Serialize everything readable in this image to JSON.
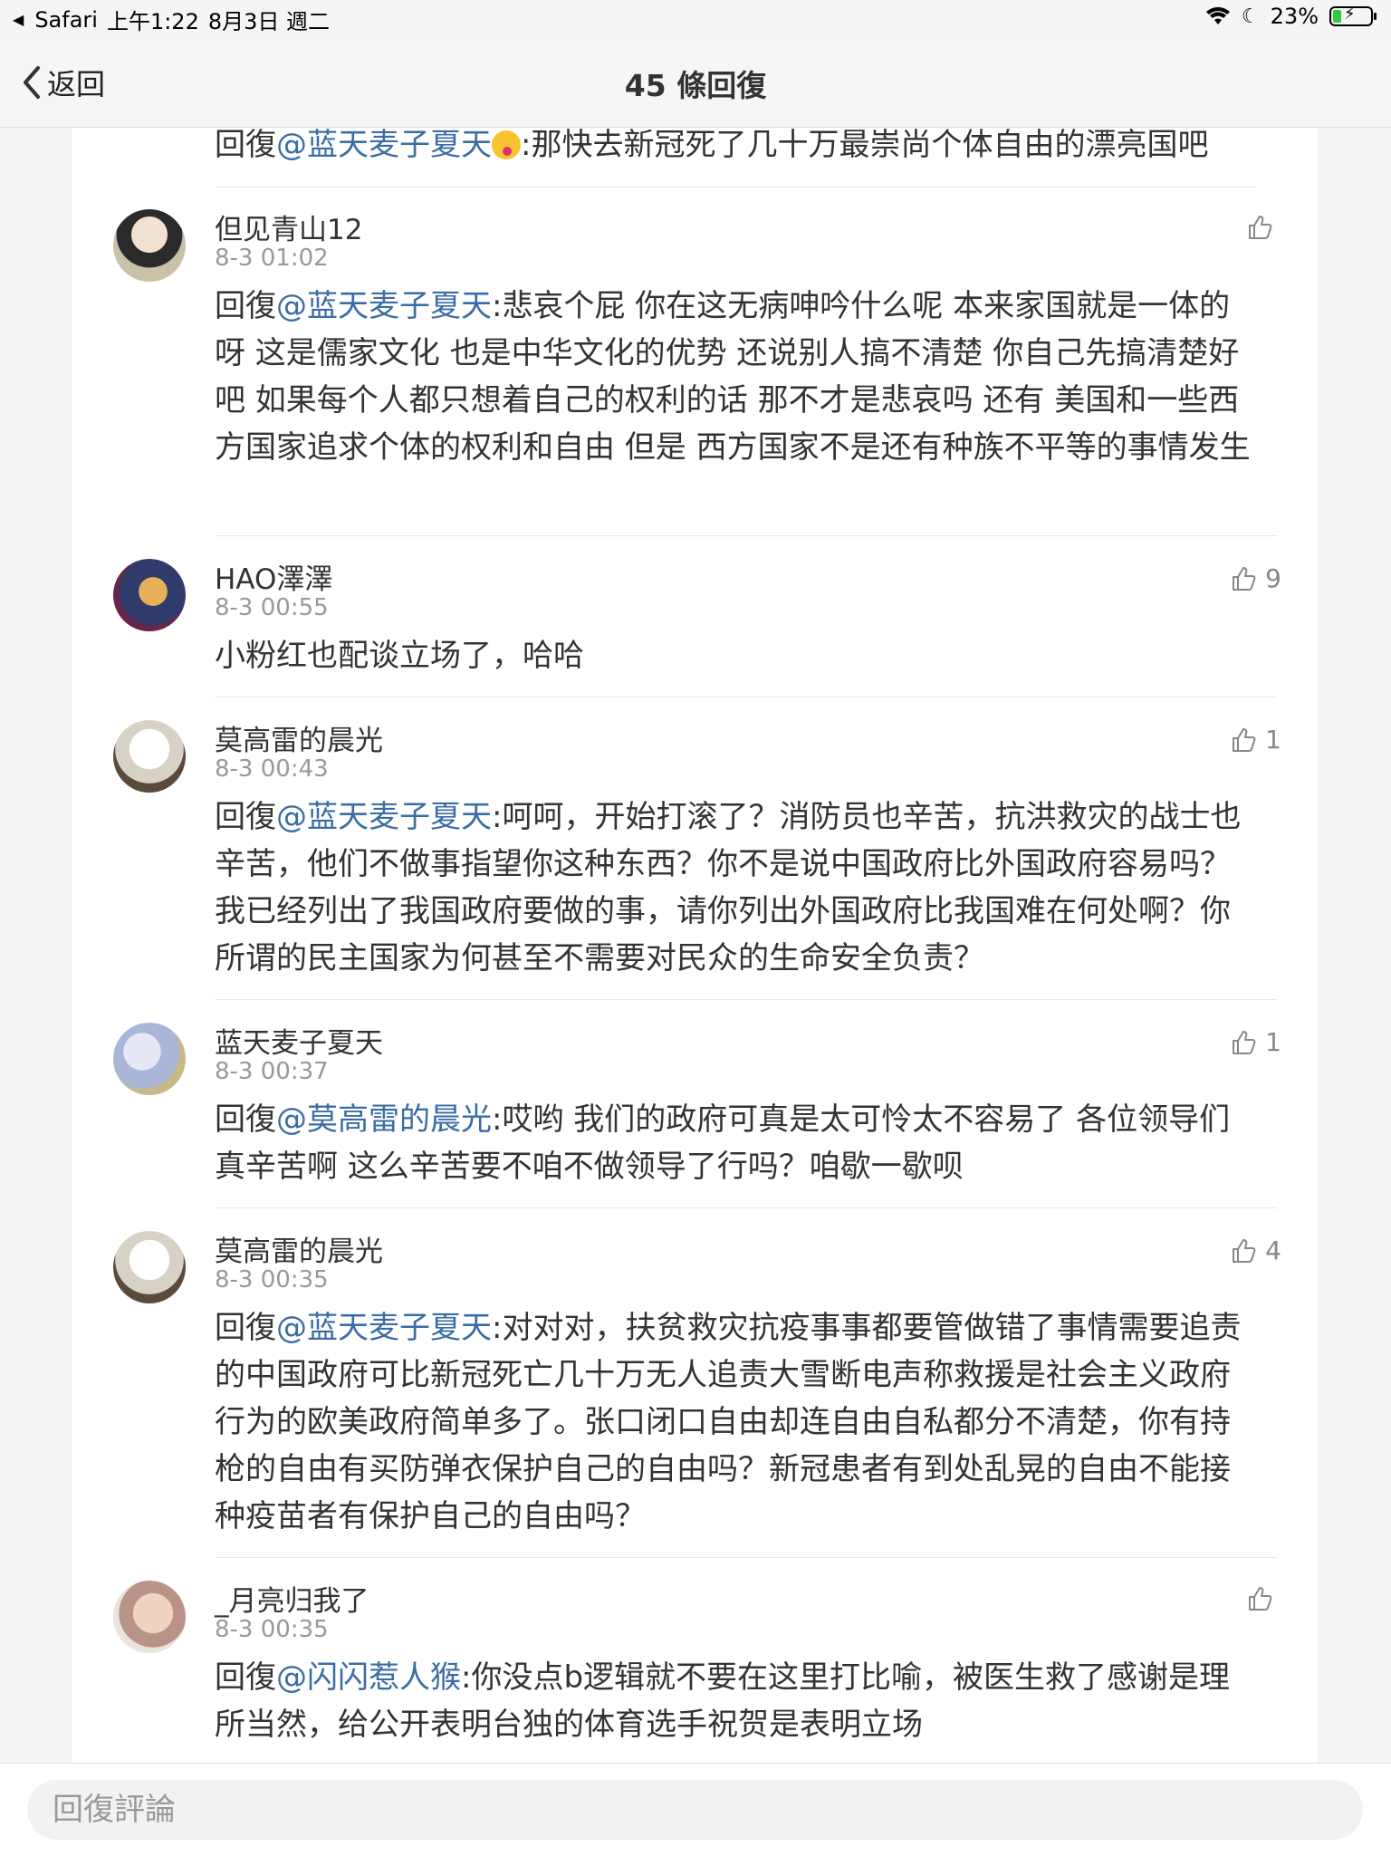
{
  "status_bar": {
    "app": "Safari",
    "time": "上午1:22",
    "date": "8月3日 週二",
    "battery": "23%",
    "battery_level": 0.23
  },
  "nav": {
    "back_label": "返回",
    "title": "45 條回復"
  },
  "partial_comment": {
    "prefix": "回復",
    "mention": "@蓝天麦子夏天",
    "text": ":那快去新冠死了几十万最崇尚个体自由的漂亮国吧"
  },
  "comments": [
    {
      "user": "但见青山12",
      "time": "8-3 01:02",
      "likes": "",
      "prefix": "回復",
      "mention": "@蓝天麦子夏天",
      "text": ":悲哀个屁  你在这无病呻吟什么呢  本来家国就是一体的呀  这是儒家文化  也是中华文化的优势  还说别人搞不清楚  你自己先搞清楚好吧  如果每个人都只想着自己的权利的话  那不才是悲哀吗  还有  美国和一些西方国家追求个体的权利和自由  但是  西方国家不是还有种族不平等的事情发生"
    },
    {
      "user": "HAO澤澤",
      "time": "8-3 00:55",
      "likes": "9",
      "prefix": "",
      "mention": "",
      "text": "小粉红也配谈立场了，哈哈"
    },
    {
      "user": "莫高雷的晨光",
      "time": "8-3 00:43",
      "likes": "1",
      "prefix": "回復",
      "mention": "@蓝天麦子夏天",
      "text": ":呵呵，开始打滚了？消防员也辛苦，抗洪救灾的战士也辛苦，他们不做事指望你这种东西？你不是说中国政府比外国政府容易吗？我已经列出了我国政府要做的事，请你列出外国政府比我国难在何处啊？你所谓的民主国家为何甚至不需要对民众的生命安全负责？"
    },
    {
      "user": "蓝天麦子夏天",
      "time": "8-3 00:37",
      "likes": "1",
      "prefix": "回復",
      "mention": "@莫高雷的晨光",
      "text": ":哎哟 我们的政府可真是太可怜太不容易了 各位领导们真辛苦啊 这么辛苦要不咱不做领导了行吗？咱歇一歇呗"
    },
    {
      "user": "莫高雷的晨光",
      "time": "8-3 00:35",
      "likes": "4",
      "prefix": "回復",
      "mention": "@蓝天麦子夏天",
      "text": ":对对对，扶贫救灾抗疫事事都要管做错了事情需要追责的中国政府可比新冠死亡几十万无人追责大雪断电声称救援是社会主义政府行为的欧美政府简单多了。张口闭口自由却连自由自私都分不清楚，你有持枪的自由有买防弹衣保护自己的自由吗？新冠患者有到处乱晃的自由不能接种疫苗者有保护自己的自由吗？"
    },
    {
      "user": "_月亮归我了",
      "time": "8-3 00:35",
      "likes": "",
      "prefix": "回復",
      "mention": "@闪闪惹人猴",
      "text": ":你没点b逻辑就不要在这里打比喻，被医生救了感谢是理所当然，给公开表明台独的体育选手祝贺是表明立场"
    }
  ],
  "bottom": {
    "reply_placeholder": "回復評論"
  }
}
